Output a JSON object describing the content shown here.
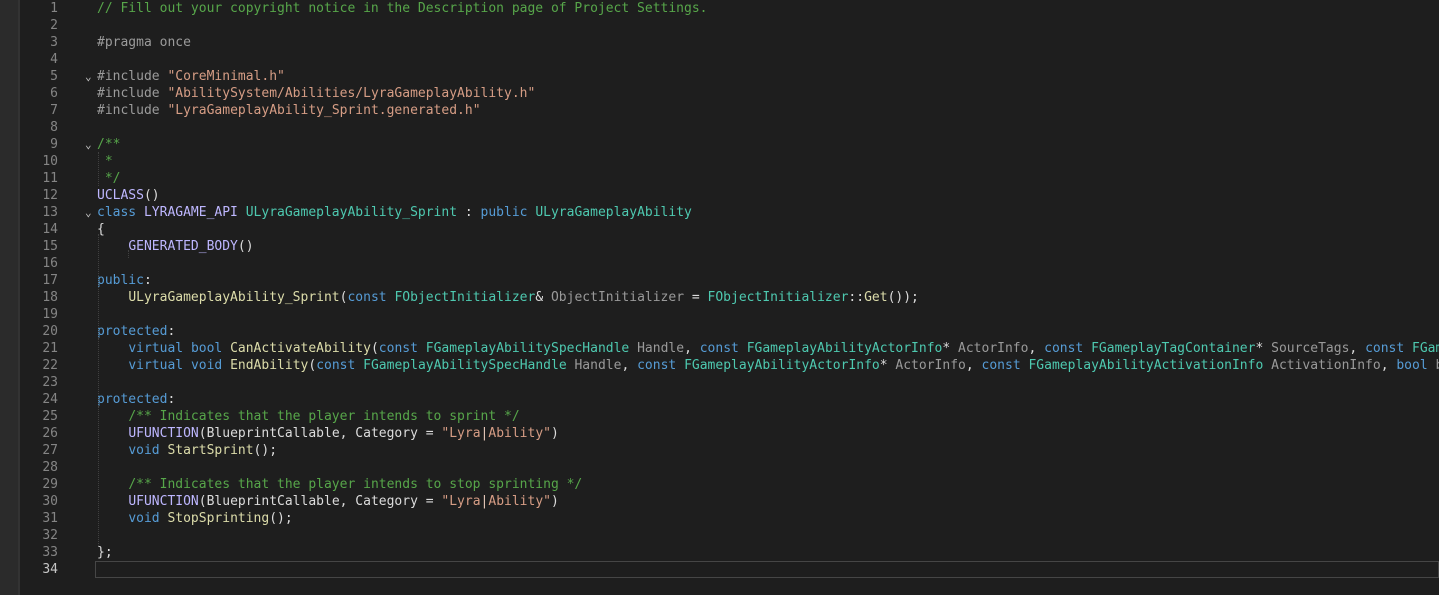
{
  "editor": {
    "active_line": "34",
    "lines": [
      {
        "n": "1",
        "fold": "",
        "tokens": [
          {
            "t": "// Fill out your copyright notice in the Description page of Project Settings.",
            "c": "comment"
          }
        ]
      },
      {
        "n": "2",
        "fold": "",
        "tokens": []
      },
      {
        "n": "3",
        "fold": "",
        "tokens": [
          {
            "t": "#pragma once",
            "c": "preproc"
          }
        ]
      },
      {
        "n": "4",
        "fold": "",
        "tokens": []
      },
      {
        "n": "5",
        "fold": "v",
        "tokens": [
          {
            "t": "#include ",
            "c": "preproc"
          },
          {
            "t": "\"CoreMinimal.h\"",
            "c": "string"
          }
        ]
      },
      {
        "n": "6",
        "fold": "",
        "tokens": [
          {
            "t": "#include ",
            "c": "preproc"
          },
          {
            "t": "\"AbilitySystem/Abilities/LyraGameplayAbility.h\"",
            "c": "string"
          }
        ]
      },
      {
        "n": "7",
        "fold": "",
        "tokens": [
          {
            "t": "#include ",
            "c": "preproc"
          },
          {
            "t": "\"LyraGameplayAbility_Sprint.generated.h\"",
            "c": "string"
          }
        ]
      },
      {
        "n": "8",
        "fold": "",
        "tokens": []
      },
      {
        "n": "9",
        "fold": "v",
        "tokens": [
          {
            "t": "/**",
            "c": "comment"
          }
        ]
      },
      {
        "n": "10",
        "fold": "",
        "tokens": [
          {
            "t": " *",
            "c": "comment"
          }
        ]
      },
      {
        "n": "11",
        "fold": "",
        "tokens": [
          {
            "t": " */",
            "c": "comment"
          }
        ]
      },
      {
        "n": "12",
        "fold": "",
        "tokens": [
          {
            "t": "UCLASS",
            "c": "macro"
          },
          {
            "t": "()",
            "c": "plain"
          }
        ]
      },
      {
        "n": "13",
        "fold": "v",
        "tokens": [
          {
            "t": "class ",
            "c": "keyword"
          },
          {
            "t": "LYRAGAME_API ",
            "c": "macro"
          },
          {
            "t": "ULyraGameplayAbility_Sprint",
            "c": "type"
          },
          {
            "t": " : ",
            "c": "plain"
          },
          {
            "t": "public ",
            "c": "keyword"
          },
          {
            "t": "ULyraGameplayAbility",
            "c": "type"
          }
        ]
      },
      {
        "n": "14",
        "fold": "",
        "tokens": [
          {
            "t": "{",
            "c": "plain"
          }
        ]
      },
      {
        "n": "15",
        "fold": "",
        "tokens": [
          {
            "t": "    ",
            "c": "plain"
          },
          {
            "t": "GENERATED_BODY",
            "c": "macro"
          },
          {
            "t": "()",
            "c": "plain"
          }
        ]
      },
      {
        "n": "16",
        "fold": "",
        "tokens": []
      },
      {
        "n": "17",
        "fold": "",
        "tokens": [
          {
            "t": "public",
            "c": "keyword"
          },
          {
            "t": ":",
            "c": "plain"
          }
        ]
      },
      {
        "n": "18",
        "fold": "",
        "tokens": [
          {
            "t": "    ",
            "c": "plain"
          },
          {
            "t": "ULyraGameplayAbility_Sprint",
            "c": "func"
          },
          {
            "t": "(",
            "c": "plain"
          },
          {
            "t": "const ",
            "c": "keyword"
          },
          {
            "t": "FObjectInitializer",
            "c": "type"
          },
          {
            "t": "& ",
            "c": "plain"
          },
          {
            "t": "ObjectInitializer",
            "c": "param"
          },
          {
            "t": " = ",
            "c": "plain"
          },
          {
            "t": "FObjectInitializer",
            "c": "type"
          },
          {
            "t": "::",
            "c": "plain"
          },
          {
            "t": "Get",
            "c": "func"
          },
          {
            "t": "());",
            "c": "plain"
          }
        ]
      },
      {
        "n": "19",
        "fold": "",
        "tokens": []
      },
      {
        "n": "20",
        "fold": "",
        "tokens": [
          {
            "t": "protected",
            "c": "keyword"
          },
          {
            "t": ":",
            "c": "plain"
          }
        ]
      },
      {
        "n": "21",
        "fold": "",
        "tokens": [
          {
            "t": "    ",
            "c": "plain"
          },
          {
            "t": "virtual ",
            "c": "keyword"
          },
          {
            "t": "bool ",
            "c": "keyword"
          },
          {
            "t": "CanActivateAbility",
            "c": "func"
          },
          {
            "t": "(",
            "c": "plain"
          },
          {
            "t": "const ",
            "c": "keyword"
          },
          {
            "t": "FGameplayAbilitySpecHandle",
            "c": "type"
          },
          {
            "t": " ",
            "c": "plain"
          },
          {
            "t": "Handle",
            "c": "param"
          },
          {
            "t": ", ",
            "c": "plain"
          },
          {
            "t": "const ",
            "c": "keyword"
          },
          {
            "t": "FGameplayAbilityActorInfo",
            "c": "type"
          },
          {
            "t": "* ",
            "c": "plain"
          },
          {
            "t": "ActorInfo",
            "c": "param"
          },
          {
            "t": ", ",
            "c": "plain"
          },
          {
            "t": "const ",
            "c": "keyword"
          },
          {
            "t": "FGameplayTagContainer",
            "c": "type"
          },
          {
            "t": "* ",
            "c": "plain"
          },
          {
            "t": "SourceTags",
            "c": "param"
          },
          {
            "t": ", ",
            "c": "plain"
          },
          {
            "t": "const ",
            "c": "keyword"
          },
          {
            "t": "FGameplay",
            "c": "type"
          }
        ]
      },
      {
        "n": "22",
        "fold": "",
        "tokens": [
          {
            "t": "    ",
            "c": "plain"
          },
          {
            "t": "virtual ",
            "c": "keyword"
          },
          {
            "t": "void ",
            "c": "keyword"
          },
          {
            "t": "EndAbility",
            "c": "func"
          },
          {
            "t": "(",
            "c": "plain"
          },
          {
            "t": "const ",
            "c": "keyword"
          },
          {
            "t": "FGameplayAbilitySpecHandle",
            "c": "type"
          },
          {
            "t": " ",
            "c": "plain"
          },
          {
            "t": "Handle",
            "c": "param"
          },
          {
            "t": ", ",
            "c": "plain"
          },
          {
            "t": "const ",
            "c": "keyword"
          },
          {
            "t": "FGameplayAbilityActorInfo",
            "c": "type"
          },
          {
            "t": "* ",
            "c": "plain"
          },
          {
            "t": "ActorInfo",
            "c": "param"
          },
          {
            "t": ", ",
            "c": "plain"
          },
          {
            "t": "const ",
            "c": "keyword"
          },
          {
            "t": "FGameplayAbilityActivationInfo",
            "c": "type"
          },
          {
            "t": " ",
            "c": "plain"
          },
          {
            "t": "ActivationInfo",
            "c": "param"
          },
          {
            "t": ", ",
            "c": "plain"
          },
          {
            "t": "bool ",
            "c": "keyword"
          },
          {
            "t": "bRepl",
            "c": "param"
          }
        ]
      },
      {
        "n": "23",
        "fold": "",
        "tokens": []
      },
      {
        "n": "24",
        "fold": "",
        "tokens": [
          {
            "t": "protected",
            "c": "keyword"
          },
          {
            "t": ":",
            "c": "plain"
          }
        ]
      },
      {
        "n": "25",
        "fold": "",
        "tokens": [
          {
            "t": "    ",
            "c": "plain"
          },
          {
            "t": "/** Indicates that the player intends to sprint */",
            "c": "comment"
          }
        ]
      },
      {
        "n": "26",
        "fold": "",
        "tokens": [
          {
            "t": "    ",
            "c": "plain"
          },
          {
            "t": "UFUNCTION",
            "c": "macro"
          },
          {
            "t": "(BlueprintCallable, Category = ",
            "c": "plain"
          },
          {
            "t": "\"Lyra",
            "c": "string"
          },
          {
            "t": "|",
            "c": "escape"
          },
          {
            "t": "Ability\"",
            "c": "string"
          },
          {
            "t": ")",
            "c": "plain"
          }
        ]
      },
      {
        "n": "27",
        "fold": "",
        "tokens": [
          {
            "t": "    ",
            "c": "plain"
          },
          {
            "t": "void ",
            "c": "keyword"
          },
          {
            "t": "StartSprint",
            "c": "func"
          },
          {
            "t": "();",
            "c": "plain"
          }
        ]
      },
      {
        "n": "28",
        "fold": "",
        "tokens": []
      },
      {
        "n": "29",
        "fold": "",
        "tokens": [
          {
            "t": "    ",
            "c": "plain"
          },
          {
            "t": "/** Indicates that the player intends to stop sprinting */",
            "c": "comment"
          }
        ]
      },
      {
        "n": "30",
        "fold": "",
        "tokens": [
          {
            "t": "    ",
            "c": "plain"
          },
          {
            "t": "UFUNCTION",
            "c": "macro"
          },
          {
            "t": "(BlueprintCallable, Category = ",
            "c": "plain"
          },
          {
            "t": "\"Lyra",
            "c": "string"
          },
          {
            "t": "|",
            "c": "escape"
          },
          {
            "t": "Ability\"",
            "c": "string"
          },
          {
            "t": ")",
            "c": "plain"
          }
        ]
      },
      {
        "n": "31",
        "fold": "",
        "tokens": [
          {
            "t": "    ",
            "c": "plain"
          },
          {
            "t": "void ",
            "c": "keyword"
          },
          {
            "t": "StopSprinting",
            "c": "func"
          },
          {
            "t": "();",
            "c": "plain"
          }
        ]
      },
      {
        "n": "32",
        "fold": "",
        "tokens": []
      },
      {
        "n": "33",
        "fold": "",
        "tokens": [
          {
            "t": "};",
            "c": "plain"
          }
        ]
      },
      {
        "n": "34",
        "fold": "",
        "tokens": []
      }
    ]
  }
}
